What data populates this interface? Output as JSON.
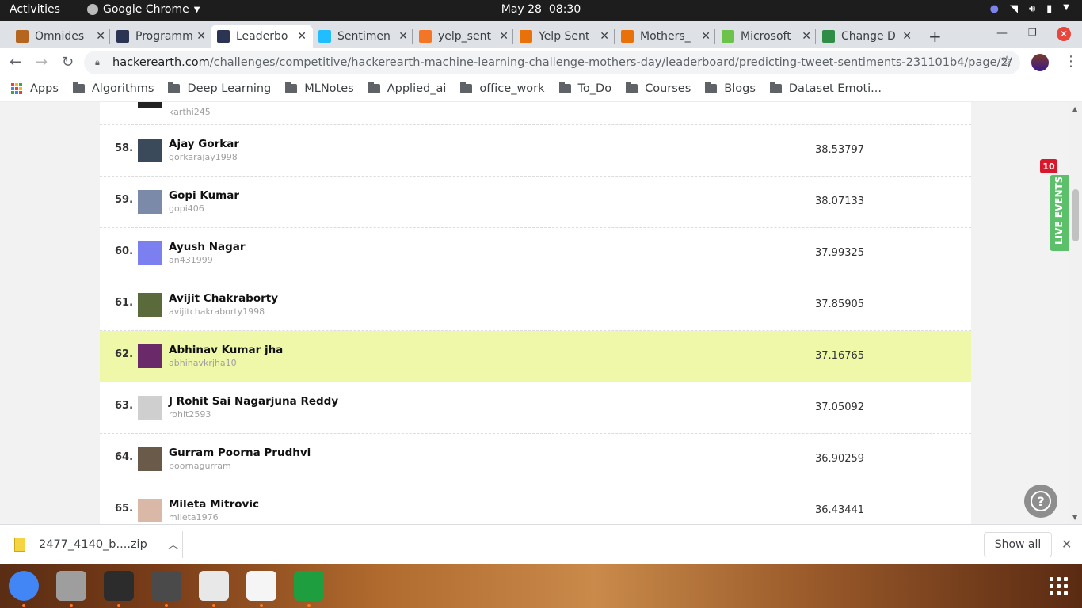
{
  "topbar": {
    "activities": "Activities",
    "app_name": "Google Chrome",
    "date": "May 28",
    "time": "08:30"
  },
  "tabs": [
    {
      "title": "Omnides",
      "favicon": "omnidesk-icon",
      "fav_color": "#b5651d"
    },
    {
      "title": "Programm",
      "favicon": "hackerearth-icon",
      "fav_color": "#2c3454"
    },
    {
      "title": "Leaderbo",
      "favicon": "hackerearth-icon",
      "fav_color": "#2c3454",
      "active": true
    },
    {
      "title": "Sentimen",
      "favicon": "kaggle-icon",
      "fav_color": "#20beff"
    },
    {
      "title": "yelp_sent",
      "favicon": "jupyter-icon",
      "fav_color": "#f37626"
    },
    {
      "title": "Yelp Sent",
      "favicon": "notebook-icon",
      "fav_color": "#e8710a"
    },
    {
      "title": "Mothers_",
      "favicon": "notebook-icon",
      "fav_color": "#e8710a"
    },
    {
      "title": "Microsoft",
      "favicon": "microsoft-icon",
      "fav_color": "#6cc24a"
    },
    {
      "title": "Change D",
      "favicon": "geeksforgeeks-icon",
      "fav_color": "#2f8d46"
    }
  ],
  "address": {
    "host": "hackerearth.com",
    "path": "/challenges/competitive/hackerearth-machine-learning-challenge-mothers-day/leaderboard/predicting-tweet-sentiments-231101b4/page/2/"
  },
  "bookmarks": {
    "apps_label": "Apps",
    "folders": [
      "Algorithms",
      "Deep Learning",
      "MLNotes",
      "Applied_ai",
      "office_work",
      "To_Do",
      "Courses",
      "Blogs",
      "Dataset Emoti..."
    ]
  },
  "leaderboard": {
    "partial_row": {
      "handle": "karthi245"
    },
    "rows": [
      {
        "rank": "58.",
        "name": "Ajay Gorkar",
        "handle": "gorkarajay1998",
        "score": "38.53797",
        "avatar_color": "#3a4a5a"
      },
      {
        "rank": "59.",
        "name": "Gopi Kumar",
        "handle": "gopi406",
        "score": "38.07133",
        "avatar_color": "#7a8aa8"
      },
      {
        "rank": "60.",
        "name": "Ayush Nagar",
        "handle": "an431999",
        "score": "37.99325",
        "avatar_color": "#7b7ff0"
      },
      {
        "rank": "61.",
        "name": "Avijit Chakraborty",
        "handle": "avijitchakraborty1998",
        "score": "37.85905",
        "avatar_color": "#5a6a3a"
      },
      {
        "rank": "62.",
        "name": "Abhinav Kumar jha",
        "handle": "abhinavkrjha10",
        "score": "37.16765",
        "avatar_color": "#6a2a6a",
        "highlight": true
      },
      {
        "rank": "63.",
        "name": "J Rohit Sai Nagarjuna Reddy",
        "handle": "rohit2593",
        "score": "37.05092",
        "avatar_color": "#cfcfcf"
      },
      {
        "rank": "64.",
        "name": "Gurram Poorna Prudhvi",
        "handle": "poornagurram",
        "score": "36.90259",
        "avatar_color": "#6a5a4a"
      },
      {
        "rank": "65.",
        "name": "Mileta Mitrovic",
        "handle": "mileta1976",
        "score": "36.43441",
        "avatar_color": "#d9b8a8"
      }
    ]
  },
  "live_events": {
    "label": "LIVE EVENTS",
    "badge": "10"
  },
  "downloads": {
    "file": "2477_4140_b....zip",
    "show_all": "Show all"
  },
  "dock": [
    {
      "name": "chrome-icon",
      "color": "#4285f4"
    },
    {
      "name": "files-icon",
      "color": "#9e9e9e"
    },
    {
      "name": "terminal-icon",
      "color": "#2c2c2c"
    },
    {
      "name": "sublime-text-icon",
      "color": "#4a4a4a"
    },
    {
      "name": "document-viewer-icon",
      "color": "#e8e8e8"
    },
    {
      "name": "text-editor-icon",
      "color": "#f5f5f5"
    },
    {
      "name": "spreadsheet-icon",
      "color": "#1e9e3e"
    }
  ]
}
